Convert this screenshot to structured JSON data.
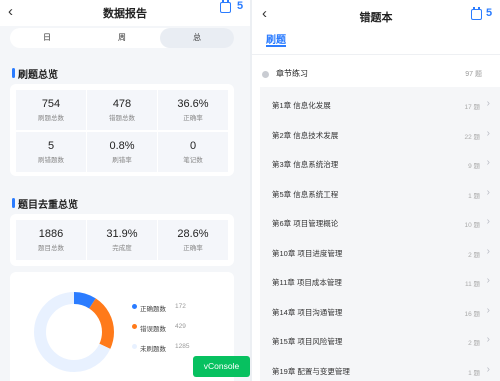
{
  "left": {
    "title": "数据报告",
    "badge": "5",
    "tabs": [
      "日",
      "周",
      "总"
    ],
    "active_tab": 2,
    "sections": [
      {
        "title": "刷题总览",
        "stats": [
          {
            "value": "754",
            "label": "刷题总数"
          },
          {
            "value": "478",
            "label": "错题总数"
          },
          {
            "value": "36.6%",
            "label": "正确率"
          },
          {
            "value": "5",
            "label": "刷错题数"
          },
          {
            "value": "0.8%",
            "label": "刷错率"
          },
          {
            "value": "0",
            "label": "笔记数"
          }
        ]
      },
      {
        "title": "题目去重总览",
        "stats": [
          {
            "value": "1886",
            "label": "题目总数"
          },
          {
            "value": "31.9%",
            "label": "完成度"
          },
          {
            "value": "28.6%",
            "label": "正确率"
          }
        ]
      }
    ],
    "legend": [
      {
        "label": "正确题数",
        "value": "172",
        "color": "#2b7cff"
      },
      {
        "label": "错误题数",
        "value": "429",
        "color": "#ff7a1a"
      },
      {
        "label": "未刷题数",
        "value": "1285",
        "color": "#e8f1ff"
      }
    ],
    "vconsole": "vConsole"
  },
  "right": {
    "title": "错题本",
    "badge": "5",
    "tab": "刷题",
    "section": {
      "title": "章节练习",
      "count": "97 题"
    },
    "chapters": [
      {
        "title": "第1章 信息化发展",
        "count": "17 题"
      },
      {
        "title": "第2章 信息技术发展",
        "count": "22 题"
      },
      {
        "title": "第3章 信息系统治理",
        "count": "9 题"
      },
      {
        "title": "第5章 信息系统工程",
        "count": "1 题"
      },
      {
        "title": "第6章 项目管理概论",
        "count": "10 题"
      },
      {
        "title": "第10章 项目进度管理",
        "count": "2 题"
      },
      {
        "title": "第11章 项目成本管理",
        "count": "11 题"
      },
      {
        "title": "第14章 项目沟通管理",
        "count": "16 题"
      },
      {
        "title": "第15章 项目风险管理",
        "count": "2 题"
      },
      {
        "title": "第19章 配置与变更管理",
        "count": "1 题"
      }
    ]
  }
}
